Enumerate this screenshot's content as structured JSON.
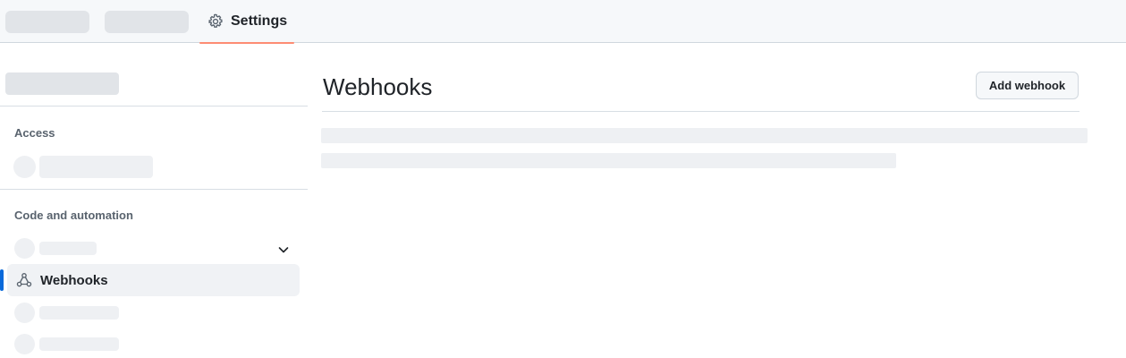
{
  "header": {
    "tabs": [
      {
        "label": ""
      },
      {
        "label": ""
      },
      {
        "label": "Settings",
        "icon": "gear-icon",
        "selected": true
      }
    ],
    "accent_color": "#fd8c73"
  },
  "sidebar": {
    "sections": [
      {
        "heading": "Access"
      },
      {
        "heading": "Code and automation"
      }
    ],
    "active_item": {
      "label": "Webhooks",
      "icon": "webhook-icon",
      "indicator_color": "#0969da"
    }
  },
  "main": {
    "title": "Webhooks",
    "add_button_label": "Add webhook"
  }
}
